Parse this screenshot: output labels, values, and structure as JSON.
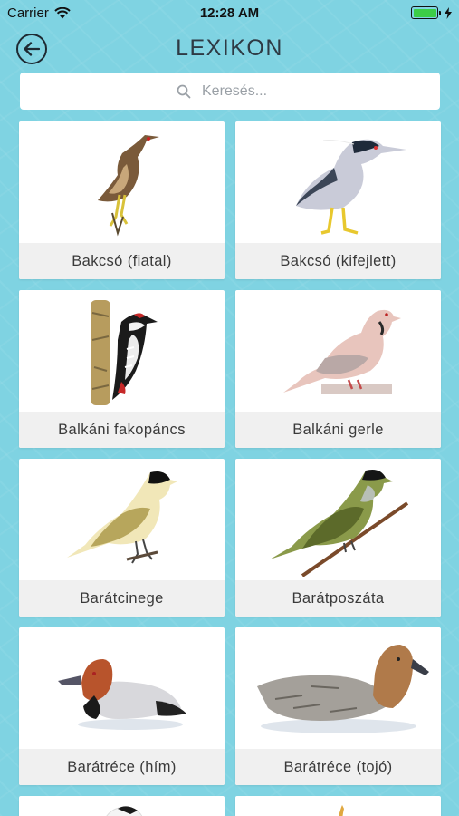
{
  "status_bar": {
    "carrier": "Carrier",
    "time": "12:28 AM",
    "battery_color": "#3ccd47"
  },
  "header": {
    "title": "LEXIKON",
    "back_icon": "back-arrow-circle-icon"
  },
  "search": {
    "placeholder": "Keresés...",
    "value": "",
    "icon": "search-icon"
  },
  "colors": {
    "background": "#7fd3e2",
    "card": "#ffffff",
    "label_bg": "#f0f0f0"
  },
  "birds": [
    {
      "label": "Bakcsó (fiatal)"
    },
    {
      "label": "Bakcsó (kifejlett)"
    },
    {
      "label": "Balkáni fakopáncs"
    },
    {
      "label": "Balkáni gerle"
    },
    {
      "label": "Barátcinege"
    },
    {
      "label": "Barátposzáta"
    },
    {
      "label": "Barátréce (hím)"
    },
    {
      "label": "Barátréce (tojó)"
    }
  ]
}
